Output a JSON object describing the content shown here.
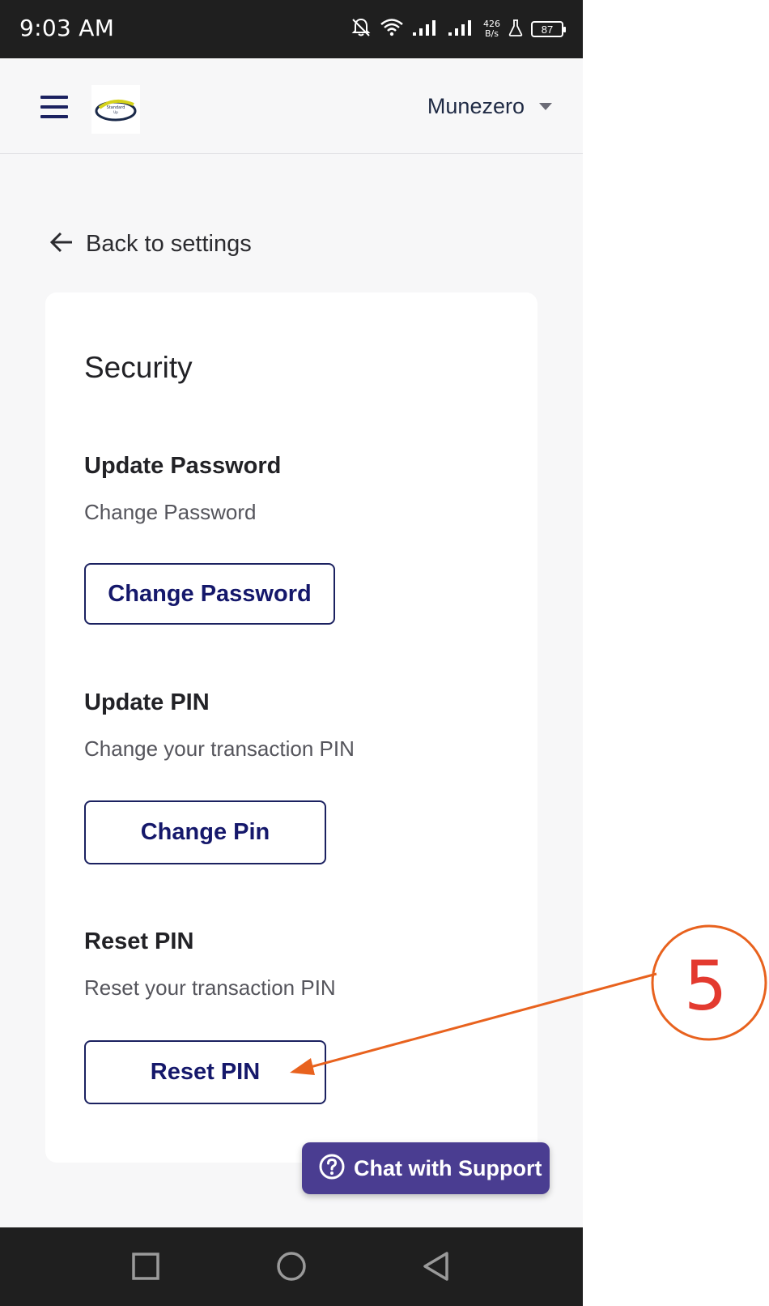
{
  "status_bar": {
    "time": "9:03 AM",
    "net_speed_value": "426",
    "net_speed_unit": "B/s",
    "battery": "87"
  },
  "header": {
    "user_name": "Munezero",
    "logo_text_line1": "Standard",
    "logo_text_line2": "Up"
  },
  "back_link": {
    "label": "Back to settings"
  },
  "card": {
    "title": "Security",
    "sections": [
      {
        "title": "Update Password",
        "description": "Change Password",
        "button_label": "Change Password"
      },
      {
        "title": "Update PIN",
        "description": "Change your transaction PIN",
        "button_label": "Change Pin"
      },
      {
        "title": "Reset PIN",
        "description": "Reset your transaction PIN",
        "button_label": "Reset PIN"
      }
    ]
  },
  "chat_support": {
    "label": "Chat with Support"
  },
  "annotation": {
    "step_number": "5"
  },
  "colors": {
    "primary_navy": "#15186b",
    "chat_purple": "#4a3d91",
    "annotation_orange": "#e8621e",
    "annotation_red": "#e33a2f"
  }
}
